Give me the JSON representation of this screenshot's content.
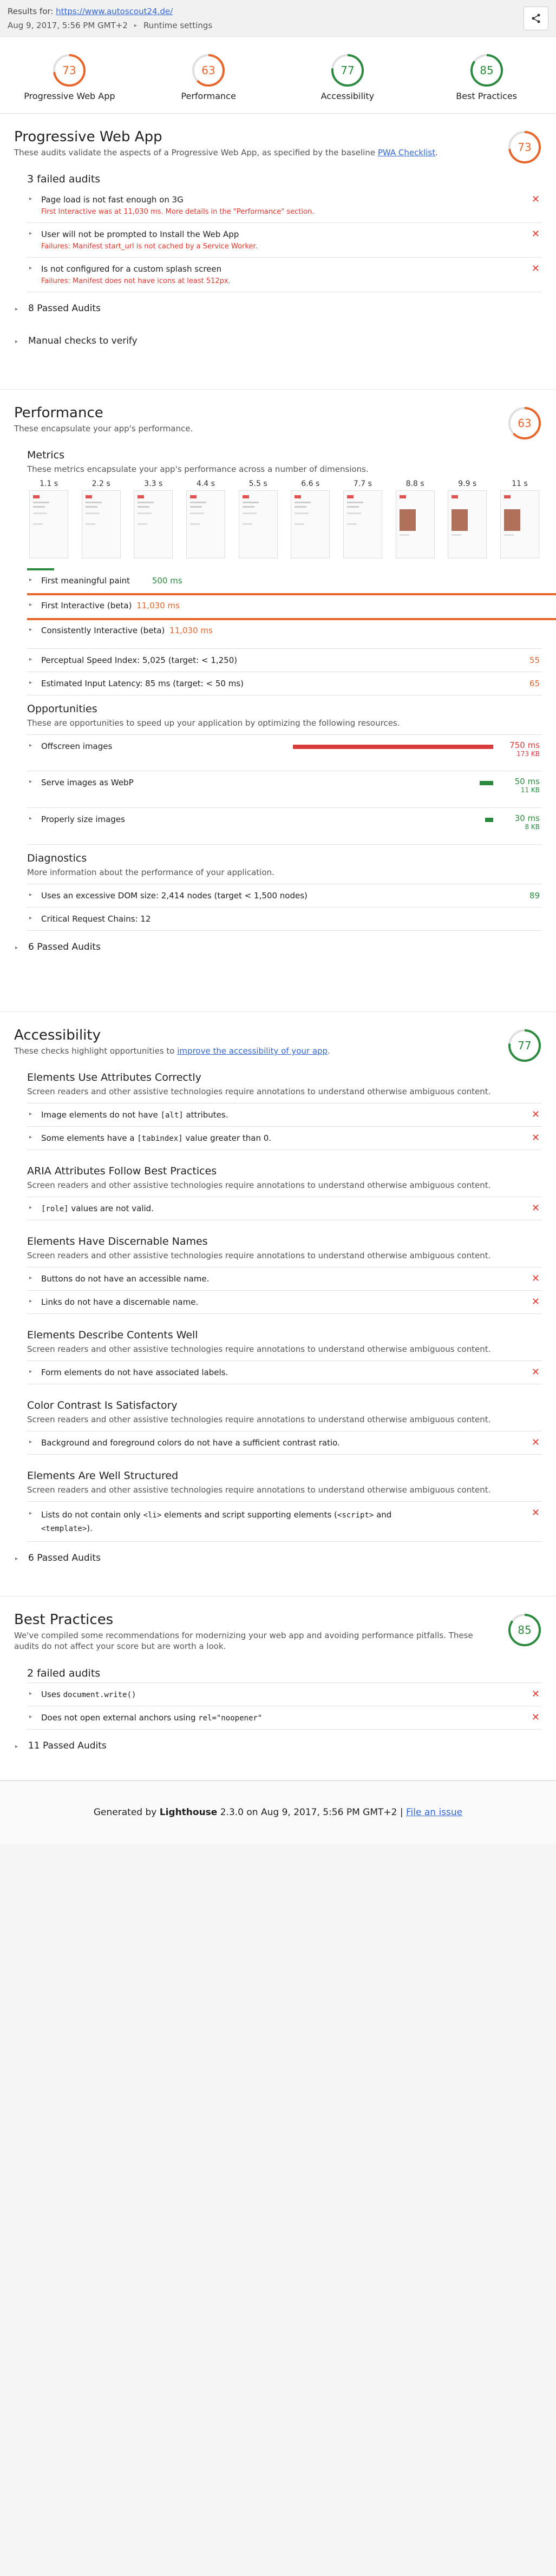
{
  "topbar": {
    "results_for_label": "Results for:",
    "url": "https://www.autoscout24.de/",
    "date": "Aug 9, 2017, 5:56 PM GMT+2",
    "runtime_label": "Runtime settings"
  },
  "gauges": [
    {
      "label": "Progressive Web App",
      "score": "73",
      "value": 73,
      "color": "#e8662c"
    },
    {
      "label": "Performance",
      "score": "63",
      "value": 63,
      "color": "#e8662c"
    },
    {
      "label": "Accessibility",
      "score": "77",
      "value": 77,
      "color": "#2b8a3e"
    },
    {
      "label": "Best Practices",
      "score": "85",
      "value": 85,
      "color": "#2b8a3e"
    }
  ],
  "pwa": {
    "title": "Progressive Web App",
    "desc": "These audits validate the aspects of a Progressive Web App, as specified by the baseline",
    "desc_link": "PWA Checklist",
    "desc_end": ".",
    "score": "73",
    "failed_title": "3 failed audits",
    "audits": [
      {
        "title": "Page load is not fast enough on 3G",
        "sub": "First Interactive was at 11,030 ms. More details in the \"Performance\" section."
      },
      {
        "title": "User will not be prompted to Install the Web App",
        "sub": "Failures: Manifest start_url is not cached by a Service Worker."
      },
      {
        "title": "Is not configured for a custom splash screen",
        "sub": "Failures: Manifest does not have icons at least 512px."
      }
    ],
    "passed": "8 Passed Audits",
    "manual": "Manual checks to verify"
  },
  "perf": {
    "title": "Performance",
    "desc": "These encapsulate your app's performance.",
    "score": "63",
    "metrics_title": "Metrics",
    "metrics_desc": "These metrics encapsulate your app's performance across a number of dimensions.",
    "frames": [
      "1.1 s",
      "2.2 s",
      "3.3 s",
      "4.4 s",
      "5.5 s",
      "6.6 s",
      "7.7 s",
      "8.8 s",
      "9.9 s",
      "11 s"
    ],
    "fmp_label": "First meaningful paint",
    "fmp_val": "500 ms",
    "fi_label": "First Interactive (beta)",
    "fi_val": "11,030 ms",
    "ci_label": "Consistently Interactive (beta)",
    "ci_val": "11,030 ms",
    "psi_label": "Perceptual Speed Index: 5,025 (target: < 1,250)",
    "psi_score": "55",
    "eil_label": "Estimated Input Latency: 85 ms (target: < 50 ms)",
    "eil_score": "65",
    "opp_title": "Opportunities",
    "opp_desc": "These are opportunities to speed up your application by optimizing the following resources.",
    "opps": [
      {
        "title": "Offscreen images",
        "a": "750 ms",
        "b": "173 KB",
        "fraction": 1.0,
        "color": "#d93a3a"
      },
      {
        "title": "Serve images as WebP",
        "a": "50 ms",
        "b": "11 KB",
        "fraction": 0.067,
        "color": "#2b8a3e"
      },
      {
        "title": "Properly size images",
        "a": "30 ms",
        "b": "8 KB",
        "fraction": 0.04,
        "color": "#2b8a3e"
      }
    ],
    "diag_title": "Diagnostics",
    "diag_desc": "More information about the performance of your application.",
    "dom_label": "Uses an excessive DOM size: 2,414 nodes (target < 1,500 nodes)",
    "dom_score": "89",
    "crc_label": "Critical Request Chains: 12",
    "passed": "6 Passed Audits"
  },
  "a11y": {
    "title": "Accessibility",
    "desc": "These checks highlight opportunities to",
    "desc_link": "improve the accessibility of your app",
    "desc_end": ".",
    "score": "77",
    "common_desc": "Screen readers and other assistive technologies require annotations to understand otherwise ambiguous content.",
    "g1_title": "Elements Use Attributes Correctly",
    "g1_a1_pre": "Image elements do not have ",
    "g1_a1_code": "[alt]",
    "g1_a1_post": " attributes.",
    "g1_a2_pre": "Some elements have a ",
    "g1_a2_code": "[tabindex]",
    "g1_a2_post": " value greater than 0.",
    "g2_title": "ARIA Attributes Follow Best Practices",
    "g2_a1_code": "[role]",
    "g2_a1_post": " values are not valid.",
    "g3_title": "Elements Have Discernable Names",
    "g3_a1": "Buttons do not have an accessible name.",
    "g3_a2": "Links do not have a discernable name.",
    "g4_title": "Elements Describe Contents Well",
    "g4_a1": "Form elements do not have associated labels.",
    "g5_title": "Color Contrast Is Satisfactory",
    "g5_a1": "Background and foreground colors do not have a sufficient contrast ratio.",
    "g6_title": "Elements Are Well Structured",
    "g6_a1_pre": "Lists do not contain only ",
    "g6_a1_code1": "<li>",
    "g6_a1_mid": " elements and script supporting elements (",
    "g6_a1_code2": "<script>",
    "g6_a1_and": " and",
    "g6_a1_code3": "<template>",
    "g6_a1_end": ").",
    "passed": "6 Passed Audits"
  },
  "bp": {
    "title": "Best Practices",
    "desc": "We've compiled some recommendations for modernizing your web app and avoiding performance pitfalls. These audits do not affect your score but are worth a look.",
    "score": "85",
    "failed_title": "2 failed audits",
    "a1_pre": "Uses ",
    "a1_code": "document.write()",
    "a2_pre": "Does not open external anchors using ",
    "a2_code": "rel=\"noopener\"",
    "passed": "11 Passed Audits"
  },
  "footer": {
    "pre": "Generated by ",
    "brand": "Lighthouse",
    "mid": " 2.3.0 on Aug 9, 2017, 5:56 PM GMT+2 | ",
    "link": "File an issue"
  }
}
